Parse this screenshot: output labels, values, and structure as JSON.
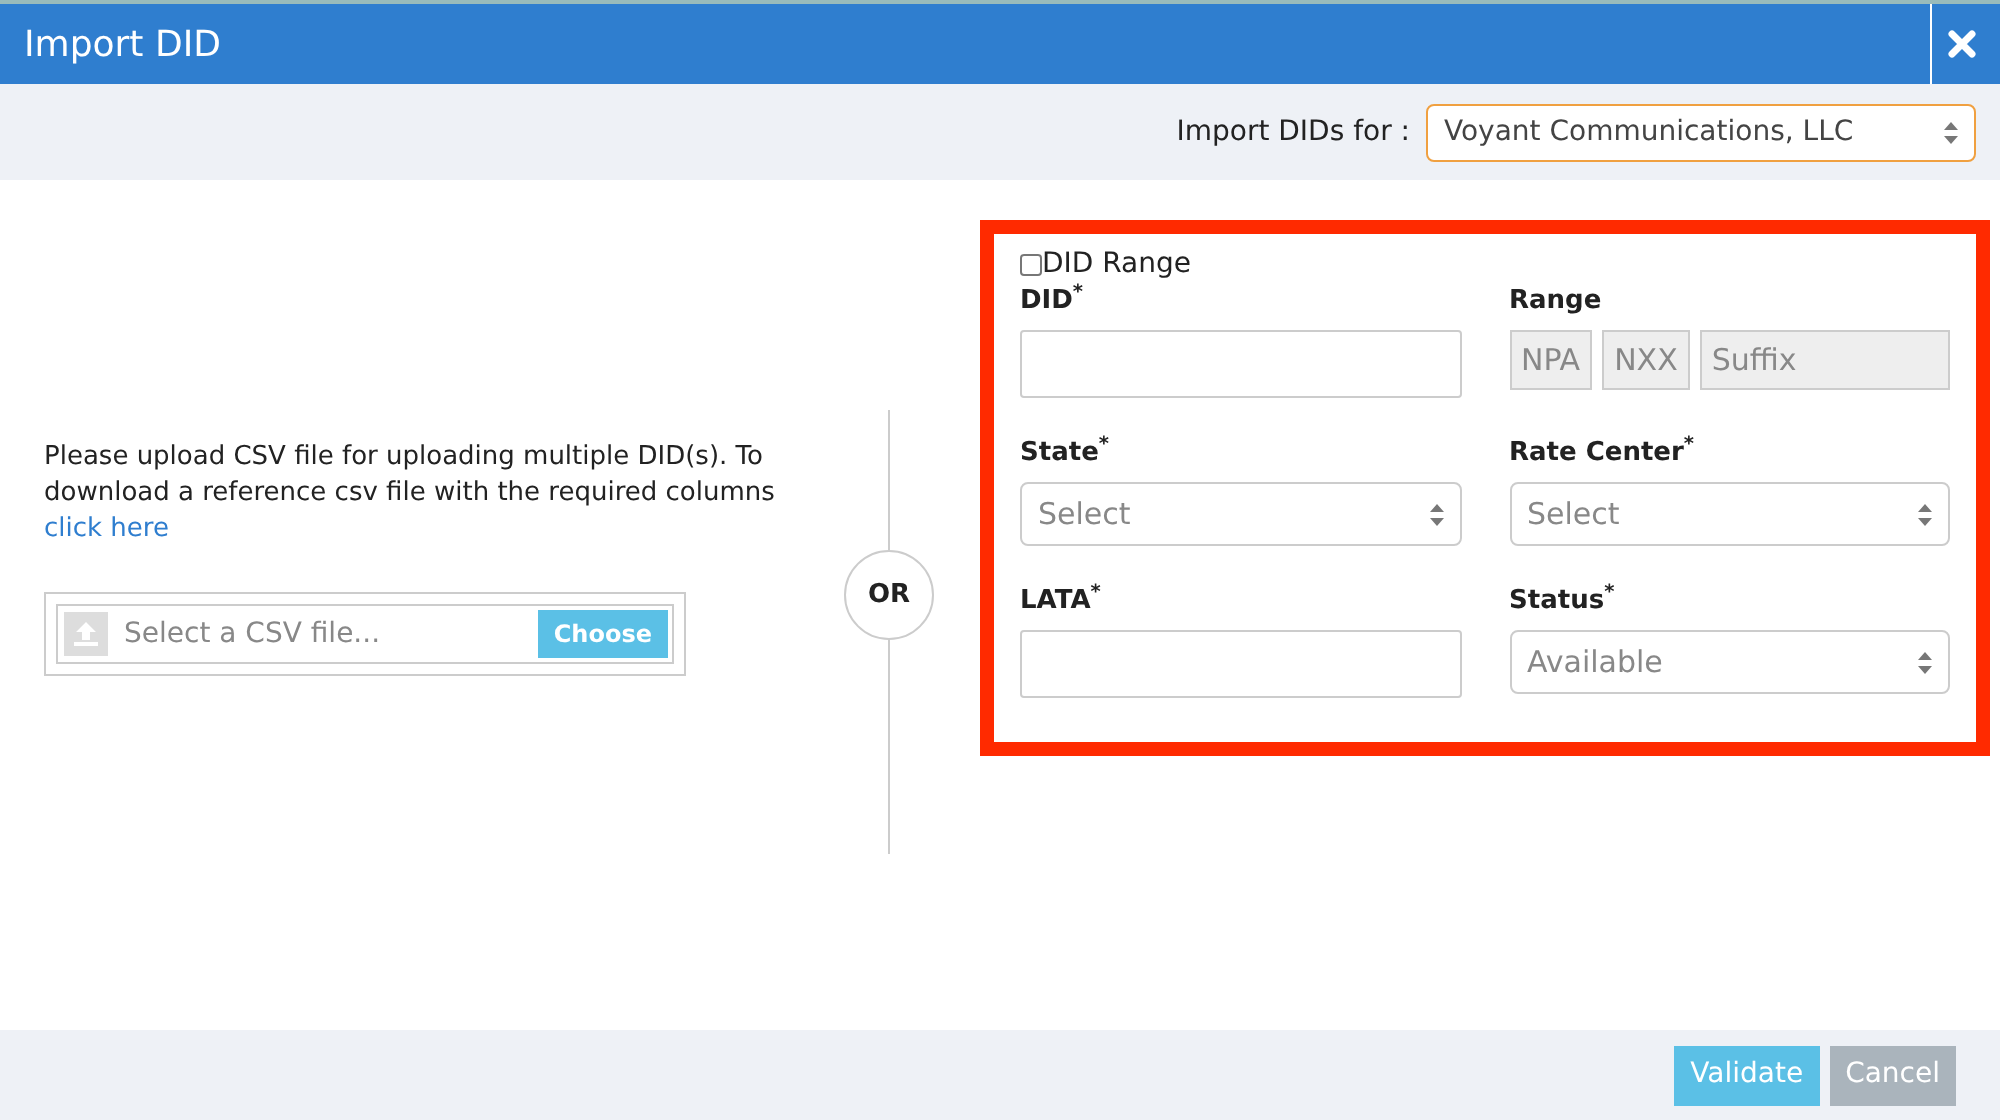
{
  "window": {
    "title": "Import DID"
  },
  "account": {
    "label": "Import DIDs for :",
    "value": "Voyant Communications, LLC"
  },
  "upload": {
    "text": "Please upload CSV file for uploading multiple DID(s). To download a reference csv file with the required columns",
    "link": "click here",
    "placeholder": "Select a CSV file...",
    "button": "Choose"
  },
  "separator": "OR",
  "form": {
    "range_toggle": {
      "label": "DID Range",
      "checked": false
    },
    "fields": [
      {
        "kind": "input",
        "label": "DID$^{*}$"
      },
      {
        "kind": "range",
        "label": "Range",
        "parts": [
          "NPA",
          "NXX",
          "Suffix"
        ]
      },
      {
        "kind": "select",
        "label": "State$^{*}$",
        "value": "Select"
      },
      {
        "kind": "select",
        "label": "Rate Center$^{*}$",
        "value": "Select"
      },
      {
        "kind": "input",
        "label": "LATA$^{*}$"
      },
      {
        "kind": "select",
        "label": "Status$^{*}$",
        "value": "Available"
      }
    ]
  },
  "buttons": [
    {
      "label": "Validate",
      "kind": "primary"
    },
    {
      "label": "Cancel",
      "kind": "secondary"
    }
  ]
}
